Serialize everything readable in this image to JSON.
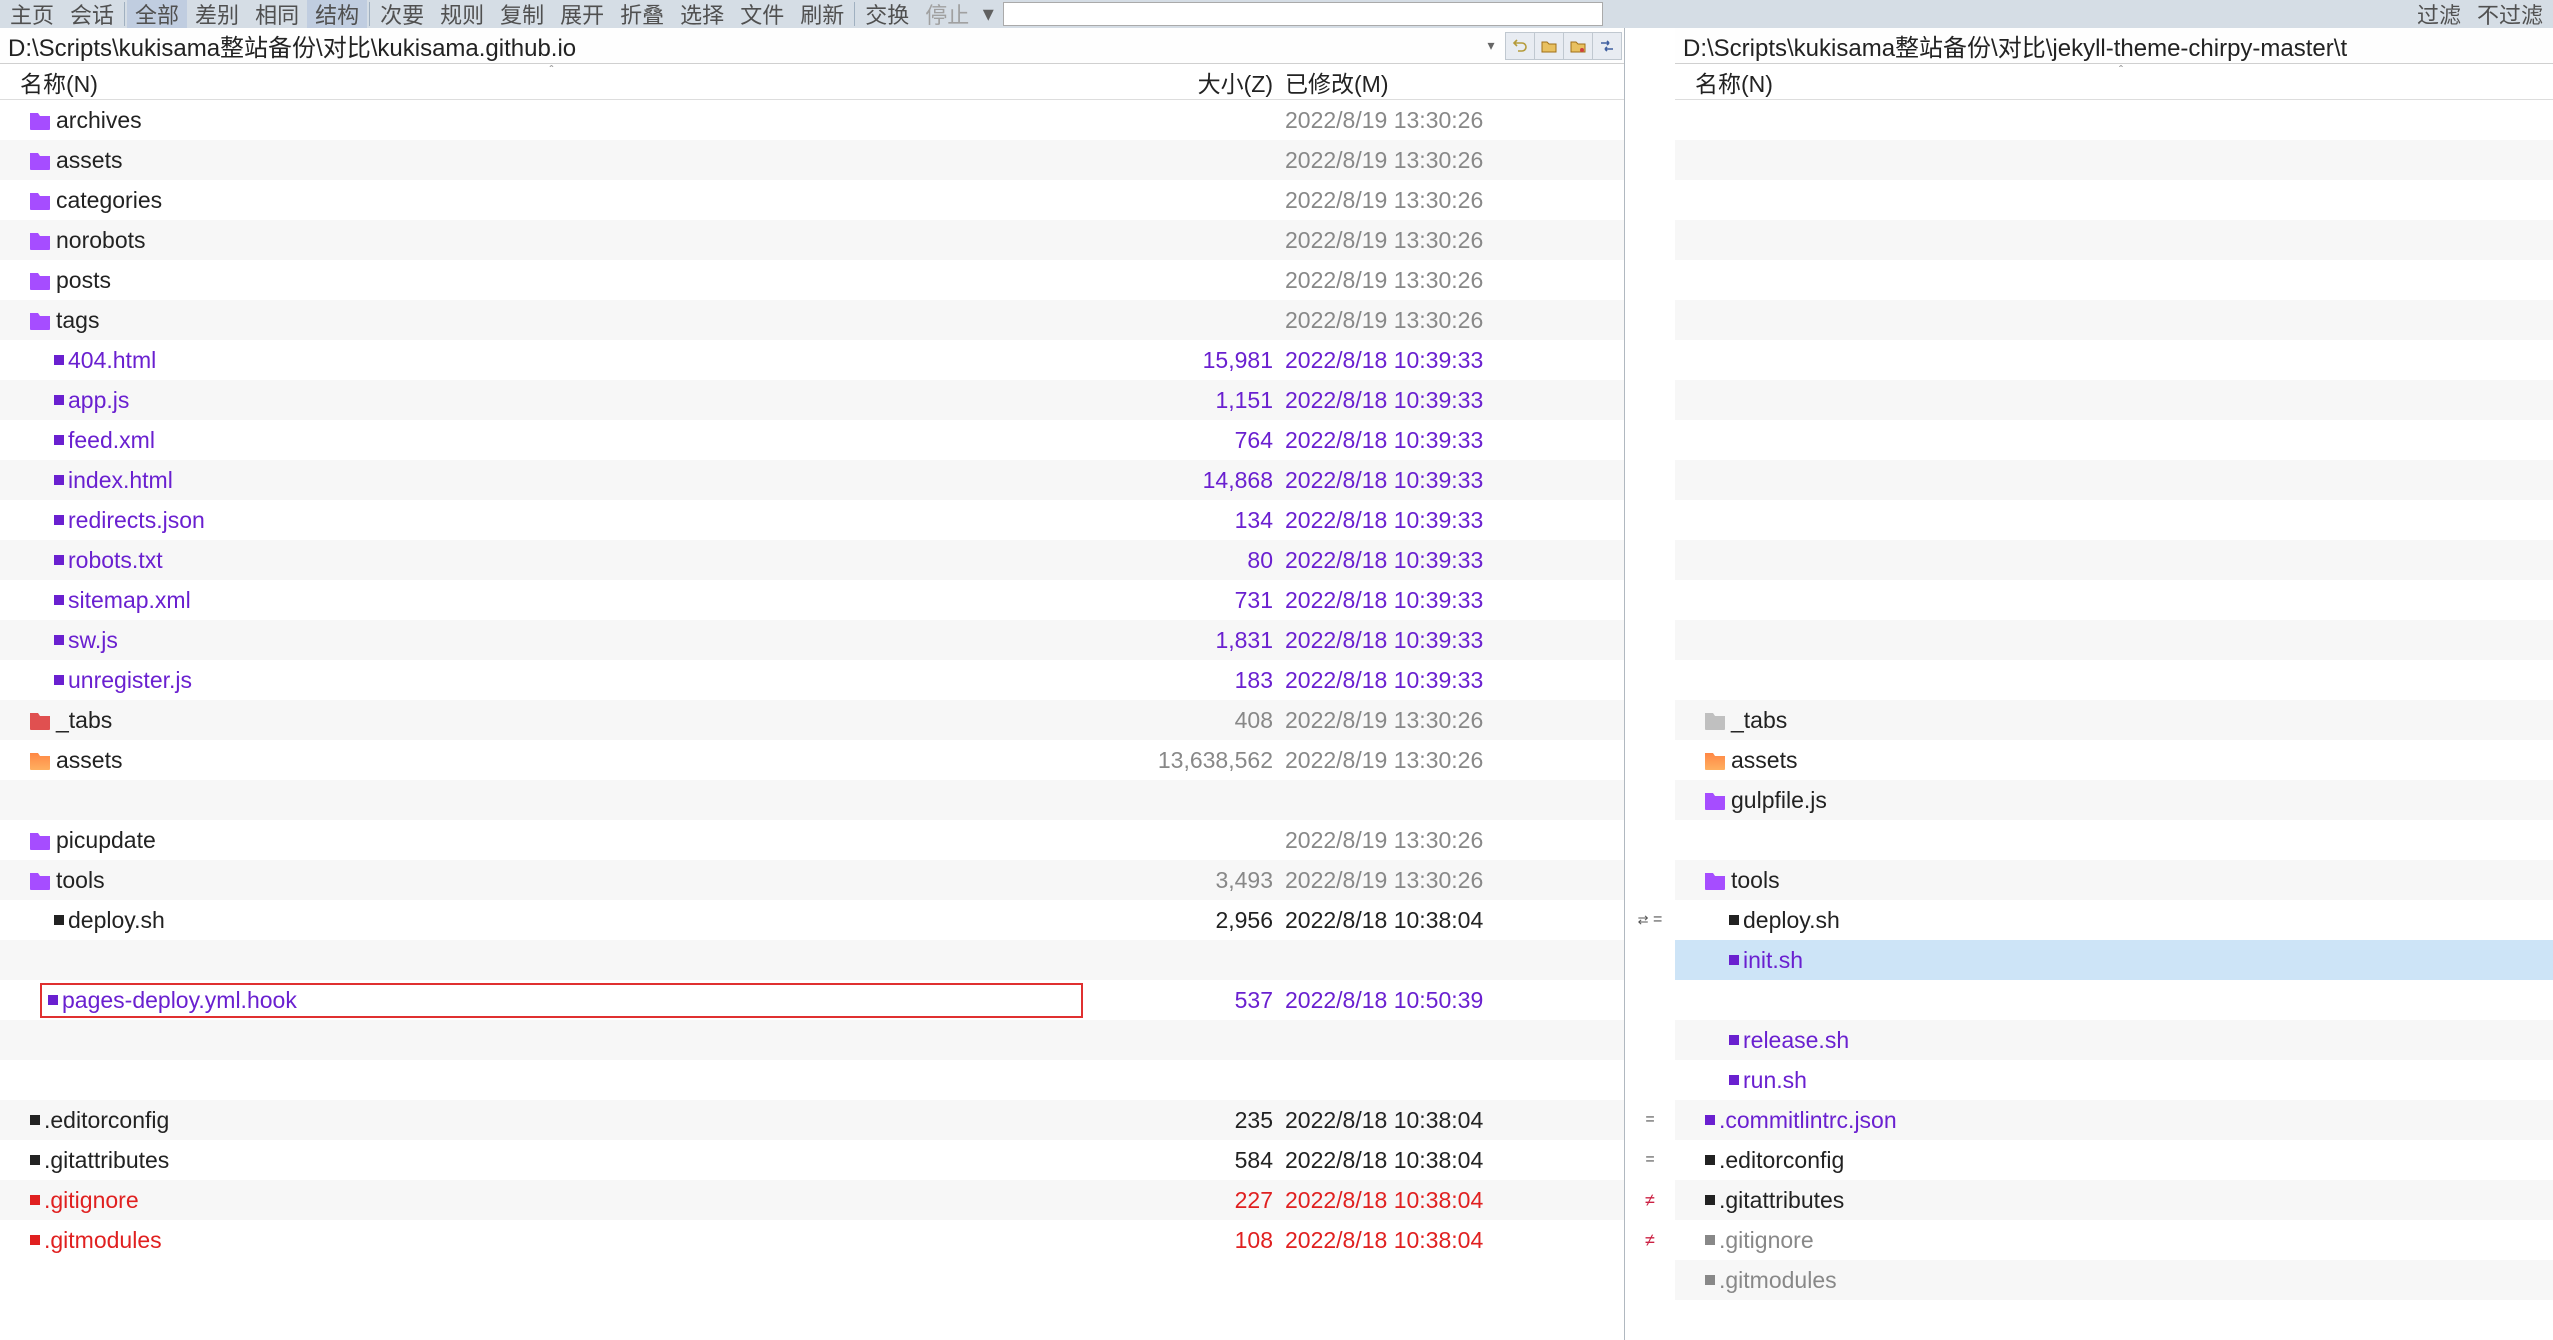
{
  "toolbar": {
    "items": [
      {
        "label": "主页",
        "active": false
      },
      {
        "label": "会话",
        "active": false
      }
    ],
    "group2": [
      {
        "label": "全部",
        "active": true
      },
      {
        "label": "差别",
        "active": false
      },
      {
        "label": "相同",
        "active": false
      },
      {
        "label": "结构",
        "active": true
      }
    ],
    "group3": [
      {
        "label": "次要",
        "active": false
      },
      {
        "label": "规则",
        "active": false
      },
      {
        "label": "复制",
        "active": false
      },
      {
        "label": "展开",
        "active": false
      },
      {
        "label": "折叠",
        "active": false
      },
      {
        "label": "选择",
        "active": false
      },
      {
        "label": "文件",
        "active": false
      },
      {
        "label": "刷新",
        "active": false
      }
    ],
    "group4": [
      {
        "label": "交换",
        "active": false
      },
      {
        "label": "停止",
        "active": false,
        "disabled": true
      }
    ],
    "right": [
      {
        "label": "过滤"
      },
      {
        "label": "不过滤"
      }
    ]
  },
  "left": {
    "path": "D:\\Scripts\\kukisama整站备份\\对比\\kukisama.github.io",
    "columns": {
      "name": "名称(N)",
      "size": "大小(Z)",
      "modified": "已修改(M)"
    },
    "rows": [
      {
        "type": "folder",
        "icon": "folder-purple",
        "name": "archives",
        "size": "",
        "date": "2022/8/19 13:30:26",
        "cls": "txt-black",
        "datec": "txt-gray",
        "indent": 0
      },
      {
        "type": "folder",
        "icon": "folder-purple",
        "name": "assets",
        "size": "",
        "date": "2022/8/19 13:30:26",
        "cls": "txt-black",
        "datec": "txt-gray",
        "indent": 0
      },
      {
        "type": "folder",
        "icon": "folder-purple",
        "name": "categories",
        "size": "",
        "date": "2022/8/19 13:30:26",
        "cls": "txt-black",
        "datec": "txt-gray",
        "indent": 0
      },
      {
        "type": "folder",
        "icon": "folder-purple",
        "name": "norobots",
        "size": "",
        "date": "2022/8/19 13:30:26",
        "cls": "txt-black",
        "datec": "txt-gray",
        "indent": 0
      },
      {
        "type": "folder",
        "icon": "folder-purple",
        "name": "posts",
        "size": "",
        "date": "2022/8/19 13:30:26",
        "cls": "txt-black",
        "datec": "txt-gray",
        "indent": 0
      },
      {
        "type": "folder",
        "icon": "folder-purple",
        "name": "tags",
        "size": "",
        "date": "2022/8/19 13:30:26",
        "cls": "txt-black",
        "datec": "txt-gray",
        "indent": 0
      },
      {
        "type": "file",
        "bullet": "#6a20d0",
        "name": "404.html",
        "size": "15,981",
        "date": "2022/8/18 10:39:33",
        "cls": "txt-purple",
        "datec": "txt-purple",
        "indent": 1
      },
      {
        "type": "file",
        "bullet": "#6a20d0",
        "name": "app.js",
        "size": "1,151",
        "date": "2022/8/18 10:39:33",
        "cls": "txt-purple",
        "datec": "txt-purple",
        "indent": 1
      },
      {
        "type": "file",
        "bullet": "#6a20d0",
        "name": "feed.xml",
        "size": "764",
        "date": "2022/8/18 10:39:33",
        "cls": "txt-purple",
        "datec": "txt-purple",
        "indent": 1
      },
      {
        "type": "file",
        "bullet": "#6a20d0",
        "name": "index.html",
        "size": "14,868",
        "date": "2022/8/18 10:39:33",
        "cls": "txt-purple",
        "datec": "txt-purple",
        "indent": 1
      },
      {
        "type": "file",
        "bullet": "#6a20d0",
        "name": "redirects.json",
        "size": "134",
        "date": "2022/8/18 10:39:33",
        "cls": "txt-purple",
        "datec": "txt-purple",
        "indent": 1
      },
      {
        "type": "file",
        "bullet": "#6a20d0",
        "name": "robots.txt",
        "size": "80",
        "date": "2022/8/18 10:39:33",
        "cls": "txt-purple",
        "datec": "txt-purple",
        "indent": 1
      },
      {
        "type": "file",
        "bullet": "#6a20d0",
        "name": "sitemap.xml",
        "size": "731",
        "date": "2022/8/18 10:39:33",
        "cls": "txt-purple",
        "datec": "txt-purple",
        "indent": 1
      },
      {
        "type": "file",
        "bullet": "#6a20d0",
        "name": "sw.js",
        "size": "1,831",
        "date": "2022/8/18 10:39:33",
        "cls": "txt-purple",
        "datec": "txt-purple",
        "indent": 1
      },
      {
        "type": "file",
        "bullet": "#6a20d0",
        "name": "unregister.js",
        "size": "183",
        "date": "2022/8/18 10:39:33",
        "cls": "txt-purple",
        "datec": "txt-purple",
        "indent": 1
      },
      {
        "type": "folder",
        "icon": "folder-red",
        "name": "_tabs",
        "size": "408",
        "date": "2022/8/19 13:30:26",
        "cls": "txt-black",
        "datec": "txt-gray",
        "indent": 0
      },
      {
        "type": "folder",
        "icon": "folder-coral",
        "name": "assets",
        "size": "13,638,562",
        "date": "2022/8/19 13:30:26",
        "cls": "txt-black",
        "datec": "txt-gray",
        "indent": 0
      },
      {
        "type": "empty"
      },
      {
        "type": "folder",
        "icon": "folder-purple",
        "name": "picupdate",
        "size": "",
        "date": "2022/8/19 13:30:26",
        "cls": "txt-black",
        "datec": "txt-gray",
        "indent": 0
      },
      {
        "type": "folder",
        "icon": "folder-purple",
        "name": "tools",
        "size": "3,493",
        "date": "2022/8/19 13:30:26",
        "cls": "txt-black",
        "datec": "txt-gray",
        "indent": 0
      },
      {
        "type": "file",
        "bullet": "#222",
        "name": "deploy.sh",
        "size": "2,956",
        "date": "2022/8/18 10:38:04",
        "cls": "txt-black",
        "datec": "txt-black",
        "indent": 1
      },
      {
        "type": "empty"
      },
      {
        "type": "file",
        "bullet": "#6a20d0",
        "name": "pages-deploy.yml.hook",
        "size": "537",
        "date": "2022/8/18 10:50:39",
        "cls": "txt-purple",
        "datec": "txt-purple",
        "indent": 1,
        "boxed": true
      },
      {
        "type": "empty"
      },
      {
        "type": "empty"
      },
      {
        "type": "file",
        "bullet": "#222",
        "name": ".editorconfig",
        "size": "235",
        "date": "2022/8/18 10:38:04",
        "cls": "txt-black",
        "datec": "txt-black",
        "indent": 0
      },
      {
        "type": "file",
        "bullet": "#222",
        "name": ".gitattributes",
        "size": "584",
        "date": "2022/8/18 10:38:04",
        "cls": "txt-black",
        "datec": "txt-black",
        "indent": 0
      },
      {
        "type": "file",
        "bullet": "#e02020",
        "name": ".gitignore",
        "size": "227",
        "date": "2022/8/18 10:38:04",
        "cls": "txt-red",
        "datec": "txt-red",
        "indent": 0
      },
      {
        "type": "file",
        "bullet": "#e02020",
        "name": ".gitmodules",
        "size": "108",
        "date": "2022/8/18 10:38:04",
        "cls": "txt-red",
        "datec": "txt-red",
        "indent": 0
      }
    ]
  },
  "center": {
    "marks": [
      "",
      "",
      "",
      "",
      "",
      "",
      "",
      "",
      "",
      "",
      "",
      "",
      "",
      "",
      "",
      "",
      "",
      "",
      "",
      "",
      "⇄ =",
      "",
      "",
      "",
      "",
      "=",
      "=",
      "≠",
      "≠"
    ]
  },
  "right": {
    "path": "D:\\Scripts\\kukisama整站备份\\对比\\jekyll-theme-chirpy-master\\t",
    "columns": {
      "name": "名称(N)"
    },
    "rows": [
      {
        "type": "empty"
      },
      {
        "type": "empty"
      },
      {
        "type": "empty"
      },
      {
        "type": "empty"
      },
      {
        "type": "empty"
      },
      {
        "type": "empty"
      },
      {
        "type": "empty"
      },
      {
        "type": "empty"
      },
      {
        "type": "empty"
      },
      {
        "type": "empty"
      },
      {
        "type": "empty"
      },
      {
        "type": "empty"
      },
      {
        "type": "empty"
      },
      {
        "type": "empty"
      },
      {
        "type": "empty"
      },
      {
        "type": "folder",
        "icon": "folder-gray",
        "name": "_tabs",
        "cls": "txt-black",
        "indent": 0
      },
      {
        "type": "folder",
        "icon": "folder-coral",
        "name": "assets",
        "cls": "txt-black",
        "indent": 0
      },
      {
        "type": "folder",
        "icon": "folder-purple",
        "name": "gulpfile.js",
        "cls": "txt-black",
        "indent": 0
      },
      {
        "type": "empty"
      },
      {
        "type": "folder",
        "icon": "folder-purple",
        "name": "tools",
        "cls": "txt-black",
        "indent": 0
      },
      {
        "type": "file",
        "bullet": "#222",
        "name": "deploy.sh",
        "cls": "txt-black",
        "indent": 1
      },
      {
        "type": "file",
        "bullet": "#6a20d0",
        "name": "init.sh",
        "cls": "txt-purple",
        "indent": 1,
        "selected": true
      },
      {
        "type": "empty"
      },
      {
        "type": "file",
        "bullet": "#6a20d0",
        "name": "release.sh",
        "cls": "txt-purple",
        "indent": 1
      },
      {
        "type": "file",
        "bullet": "#6a20d0",
        "name": "run.sh",
        "cls": "txt-purple",
        "indent": 1
      },
      {
        "type": "file",
        "bullet": "#6a20d0",
        "name": ".commitlintrc.json",
        "cls": "txt-purple",
        "indent": 0
      },
      {
        "type": "file",
        "bullet": "#222",
        "name": ".editorconfig",
        "cls": "txt-black",
        "indent": 0
      },
      {
        "type": "file",
        "bullet": "#222",
        "name": ".gitattributes",
        "cls": "txt-black",
        "indent": 0
      },
      {
        "type": "file",
        "bullet": "#888",
        "name": ".gitignore",
        "cls": "txt-gray",
        "indent": 0
      },
      {
        "type": "file",
        "bullet": "#888",
        "name": ".gitmodules",
        "cls": "txt-gray",
        "indent": 0
      }
    ]
  }
}
